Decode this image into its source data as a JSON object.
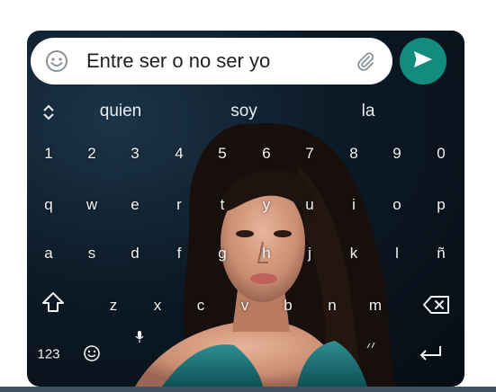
{
  "input": {
    "message_text": "Entre ser o no ser yo",
    "emoji_icon": "emoji-icon",
    "attach_icon": "paperclip-icon",
    "send_icon": "send-arrow-icon",
    "send_color": "#128c7e"
  },
  "suggestions": {
    "expand_icon": "expand-chevrons-icon",
    "items": [
      "quien",
      "soy",
      "la"
    ]
  },
  "keyboard": {
    "number_row": [
      "1",
      "2",
      "3",
      "4",
      "5",
      "6",
      "7",
      "8",
      "9",
      "0"
    ],
    "row_q": [
      "q",
      "w",
      "e",
      "r",
      "t",
      "y",
      "u",
      "i",
      "o",
      "p"
    ],
    "row_a": [
      "a",
      "s",
      "d",
      "f",
      "g",
      "h",
      "j",
      "k",
      "l",
      "ñ"
    ],
    "row_z": [
      "z",
      "x",
      "c",
      "v",
      "b",
      "n",
      "m"
    ],
    "shift_icon": "shift-arrow-icon",
    "backspace_icon": "backspace-icon",
    "symbols_label": "123",
    "emoji_key_icon": "emoji-icon",
    "mic_icon": "microphone-icon",
    "enter_icon": "enter-return-icon"
  }
}
